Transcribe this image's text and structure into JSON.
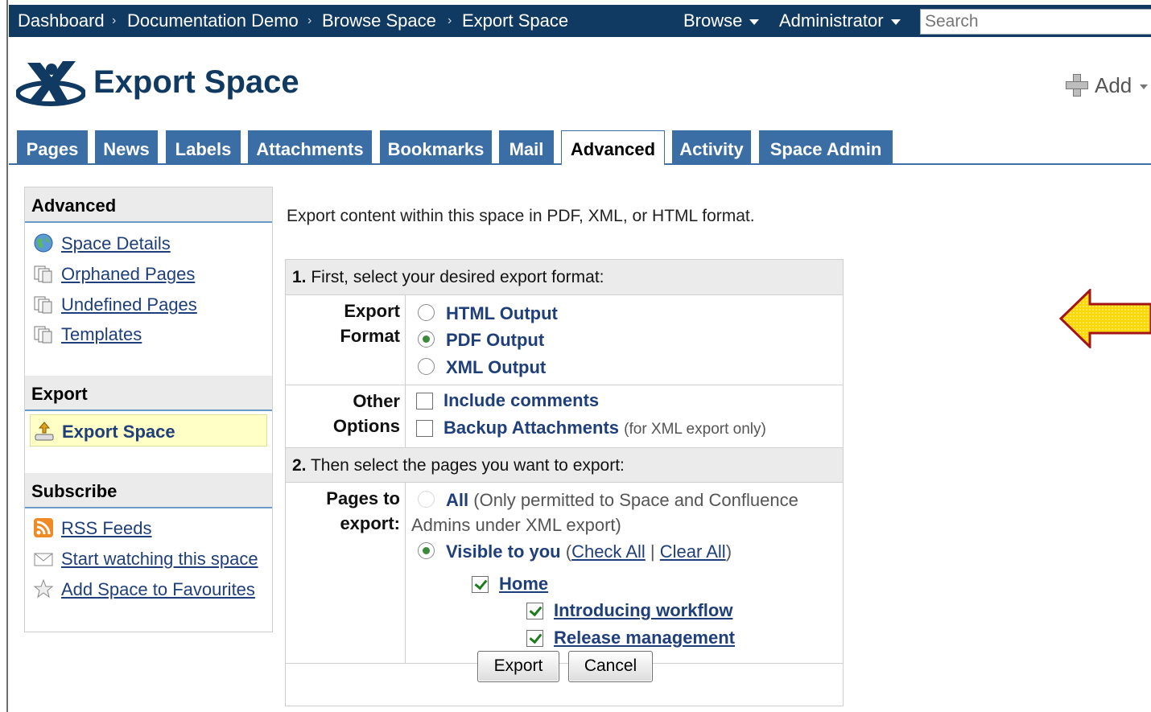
{
  "breadcrumb": [
    "Dashboard",
    "Documentation Demo",
    "Browse Space",
    "Export Space"
  ],
  "breadcrumb_sep": "›",
  "top_menu": {
    "browse": "Browse",
    "user": "Administrator"
  },
  "search": {
    "placeholder": "Search"
  },
  "page": {
    "title": "Export Space",
    "add_label": "Add"
  },
  "tabs": [
    "Pages",
    "News",
    "Labels",
    "Attachments",
    "Bookmarks",
    "Mail",
    "Advanced",
    "Activity",
    "Space Admin"
  ],
  "active_tab": "Advanced",
  "sidebar": {
    "advanced_heading": "Advanced",
    "advanced_links": [
      "Space Details",
      "Orphaned Pages",
      "Undefined Pages",
      "Templates"
    ],
    "export_heading": "Export",
    "export_link": "Export Space",
    "subscribe_heading": "Subscribe",
    "subscribe_links": [
      "RSS Feeds",
      "Start watching this space",
      "Add Space to Favourites"
    ]
  },
  "main": {
    "intro": "Export content within this space in PDF, XML, or HTML format.",
    "step1_num": "1.",
    "step1": "First, select your desired export format:",
    "format_label_1": "Export",
    "format_label_2": "Format",
    "formats": [
      "HTML Output",
      "PDF Output",
      "XML Output"
    ],
    "selected_format": "PDF Output",
    "other_label_1": "Other",
    "other_label_2": "Options",
    "include_comments": "Include comments",
    "backup_attachments": "Backup Attachments",
    "backup_note": "(for XML export only)",
    "step2_num": "2.",
    "step2": "Then select the pages you want to export:",
    "pages_label_1": "Pages to",
    "pages_label_2": "export:",
    "all_label": "All",
    "all_note_1": "(Only permitted to Space and Confluence",
    "all_note_2": "Admins under XML export)",
    "visible_label": "Visible to you",
    "open_paren": "(",
    "check_all": "Check All",
    "pipe": "|",
    "clear_all": "Clear All",
    "close_paren": ")",
    "tree": [
      "Home",
      "Introducing workflow",
      "Release management"
    ],
    "export_button": "Export",
    "cancel_button": "Cancel"
  },
  "colors": {
    "topbar": "#113a63",
    "tab": "#3b6ea5",
    "link": "#1f3f7a",
    "highlight": "#ffffc6",
    "arrow": "#ffd700"
  }
}
